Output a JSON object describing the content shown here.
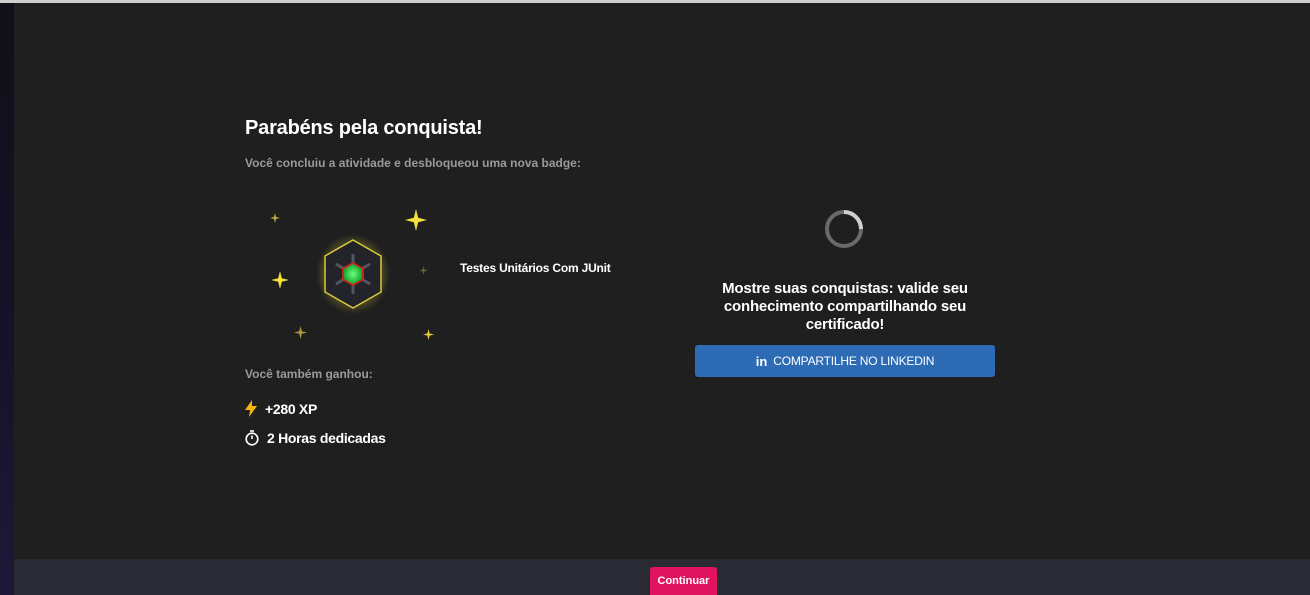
{
  "achievement": {
    "title": "Parabéns pela conquista!",
    "subtitle": "Você concluiu a atividade e desbloqueou uma nova badge:",
    "badge_name": "Testes Unitários Com JUnit",
    "badge_icon": "hexagon-badge-icon"
  },
  "rewards": {
    "label": "Você também ganhou:",
    "items": [
      {
        "icon": "lightning-icon",
        "text": "+280 XP"
      },
      {
        "icon": "stopwatch-icon",
        "text": "2 Horas dedicadas"
      }
    ]
  },
  "share": {
    "message": "Mostre suas conquistas: valide seu conhecimento compartilhando seu certificado!",
    "linkedin_icon_text": "in",
    "linkedin_label": "COMPARTILHE NO LINKEDIN"
  },
  "footer": {
    "continue_label": "Continuar"
  },
  "colors": {
    "background": "#1f1f1f",
    "footer": "#2a2a35",
    "linkedin": "#2d6bb5",
    "continue": "#e0145e",
    "spark": "#f5e23a",
    "badge_gem": "#22c84a"
  }
}
